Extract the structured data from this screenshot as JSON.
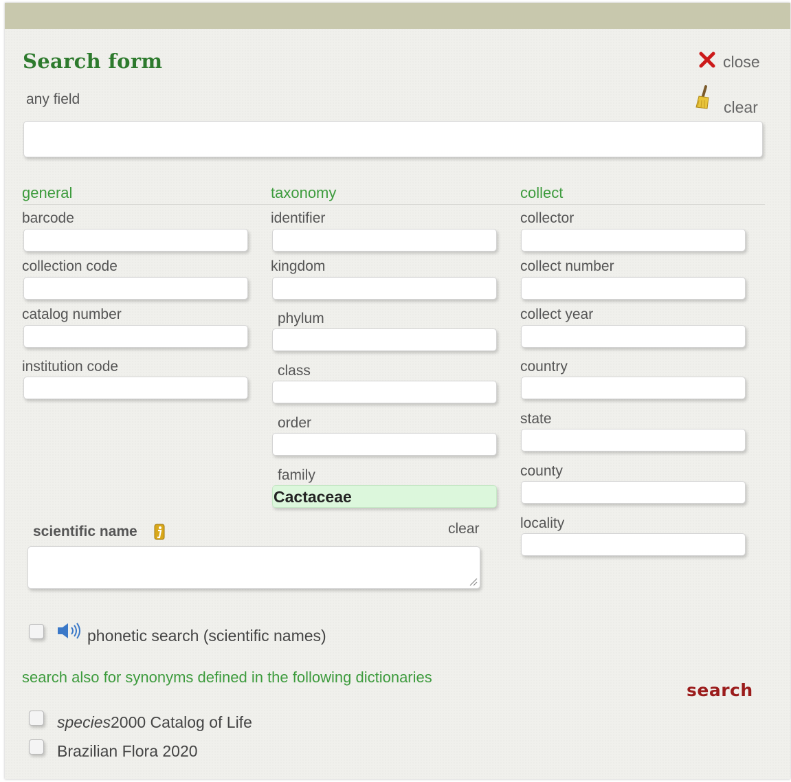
{
  "form": {
    "title": "Search form",
    "close_label": "close",
    "clear_label": "clear",
    "any_field_label": "any field",
    "any_field_value": ""
  },
  "sections": {
    "general": "general",
    "taxonomy": "taxonomy",
    "collect": "collect"
  },
  "general": {
    "barcode": "barcode",
    "collection_code": "collection code",
    "catalog_number": "catalog number",
    "institution_code": "institution code"
  },
  "taxonomy": {
    "identifier": "identifier",
    "kingdom": "kingdom",
    "phylum": "phylum",
    "class": "class",
    "order": "order",
    "family": "family",
    "family_value": "Cactaceae"
  },
  "collect": {
    "collector": "collector",
    "collect_number": "collect number",
    "collect_year": "collect year",
    "country": "country",
    "state": "state",
    "county": "county",
    "locality": "locality"
  },
  "scientific": {
    "label": "scientific name",
    "info_icon": "info-icon",
    "clear_label": "clear"
  },
  "phonetic": {
    "label": "phonetic search (scientific names)",
    "icon": "speaker-icon",
    "checked": false
  },
  "synonyms": {
    "heading": "search also for synonyms defined in the following dictionaries",
    "dict1_italic": "species",
    "dict1_rest": "2000 Catalog of Life",
    "dict2": "Brazilian Flora 2020"
  },
  "search_label": "search",
  "colors": {
    "title_green": "#2d7a2d",
    "section_green": "#3d9b3d",
    "search_red": "#9b1c1c",
    "close_red": "#cc1a1a",
    "topbar": "#c8c8ad",
    "highlight_field": "#dcf7dc"
  }
}
